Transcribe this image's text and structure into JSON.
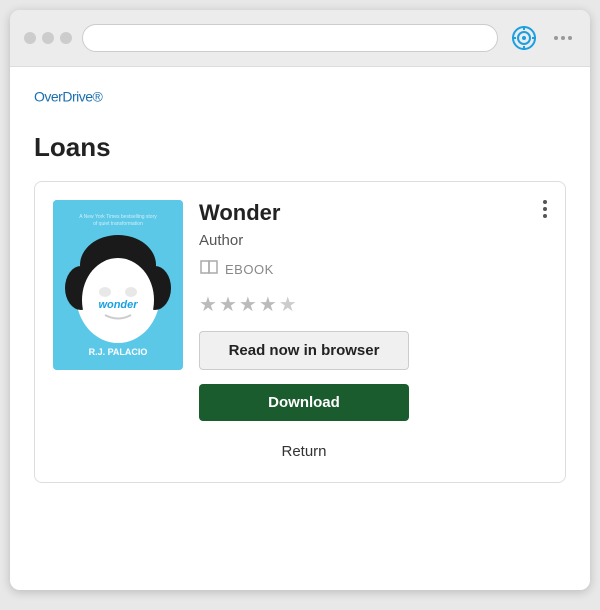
{
  "window": {
    "title": "OverDrive"
  },
  "titlebar": {
    "dots_label": "menu"
  },
  "brand": {
    "logo": "OverDrive",
    "trademark": "®"
  },
  "page": {
    "title": "Loans"
  },
  "book": {
    "title": "Wonder",
    "author": "Author",
    "format": "EBOOK",
    "stars_filled": 4,
    "stars_total": 5,
    "btn_read": "Read now in browser",
    "btn_download": "Download",
    "btn_return": "Return"
  }
}
